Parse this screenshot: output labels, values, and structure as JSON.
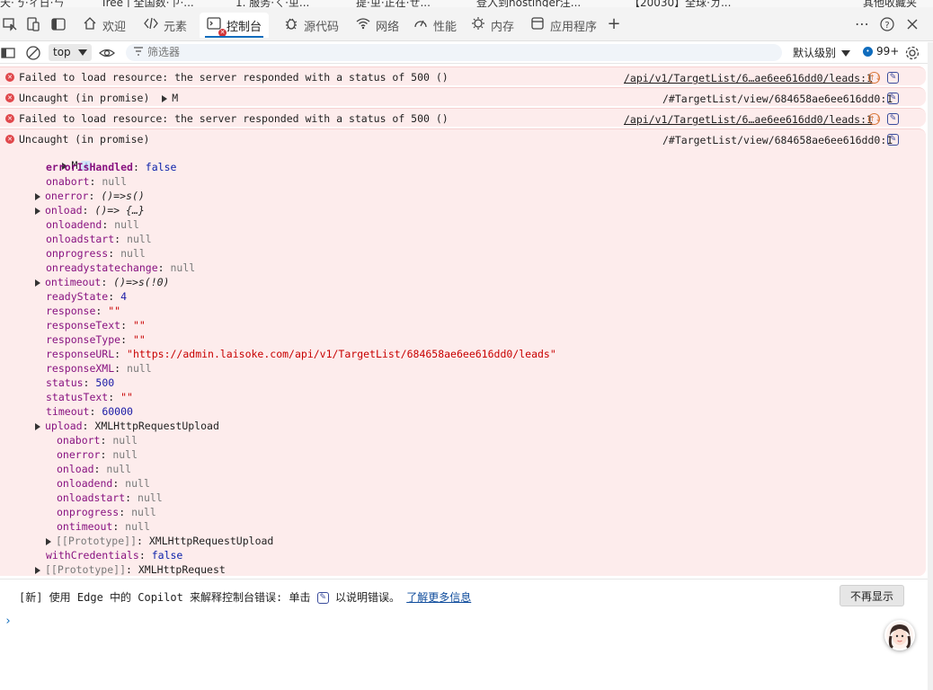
{
  "bookmarks": [
    {
      "label": "天·ㄋ·ㄔ日·ㄣ"
    },
    {
      "label": "Tree | 全国数·ㄗ·..."
    },
    {
      "label": "1. 服务·ㄑ·ㄓ..."
    },
    {
      "label": "提·ㄓ·正在·ㄝ..."
    },
    {
      "label": "登入到hostinger注..."
    },
    {
      "label": "【20030】全球·ㄉ..."
    },
    {
      "label": "其他收藏夹"
    }
  ],
  "tabs": [
    {
      "label": "欢迎",
      "icon": "home-icon"
    },
    {
      "label": "元素",
      "icon": "code-icon"
    },
    {
      "label": "控制台",
      "icon": "console-icon",
      "active": true
    },
    {
      "label": "源代码",
      "icon": "bug-icon"
    },
    {
      "label": "网络",
      "icon": "wifi-icon"
    },
    {
      "label": "性能",
      "icon": "gauge-icon"
    },
    {
      "label": "内存",
      "icon": "memory-icon"
    },
    {
      "label": "应用程序",
      "icon": "app-icon"
    }
  ],
  "toolbar": {
    "context": "top",
    "filter_placeholder": "筛选器",
    "levels": "默认级别",
    "count": "99+"
  },
  "messages": [
    {
      "text": "Failed to load resource: the server responded with a status of 500 ()",
      "source": "/api/v1/TargetList/6…ae6ee616dd0/leads:1"
    },
    {
      "text": "Uncaught (in promise)",
      "inline": "M",
      "source": "/#TargetList/view/684658ae6ee616dd0:1"
    },
    {
      "text": "Failed to load resource: the server responded with a status of 500 ()",
      "source": "/api/v1/TargetList/6…ae6ee616dd0/leads:1"
    },
    {
      "text": "Uncaught (in promise)",
      "source": "/#TargetList/view/684658ae6ee616dd0:1"
    }
  ],
  "tree": {
    "root": "M",
    "lines": [
      {
        "key": "errorIsHandled",
        "value": "false",
        "type": "kw",
        "bold": true
      },
      {
        "key": "onabort",
        "value": "null",
        "type": "null"
      },
      {
        "key": "onerror",
        "value": "()=>s()",
        "type": "fn",
        "expand": true
      },
      {
        "key": "onload",
        "value": "()=> {…}",
        "type": "fn",
        "expand": true
      },
      {
        "key": "onloadend",
        "value": "null",
        "type": "null"
      },
      {
        "key": "onloadstart",
        "value": "null",
        "type": "null"
      },
      {
        "key": "onprogress",
        "value": "null",
        "type": "null"
      },
      {
        "key": "onreadystatechange",
        "value": "null",
        "type": "null"
      },
      {
        "key": "ontimeout",
        "value": "()=>s(!0)",
        "type": "fn",
        "expand": true
      },
      {
        "key": "readyState",
        "value": "4",
        "type": "num"
      },
      {
        "key": "response",
        "value": "\"\"",
        "type": "str"
      },
      {
        "key": "responseText",
        "value": "\"\"",
        "type": "str"
      },
      {
        "key": "responseType",
        "value": "\"\"",
        "type": "str"
      },
      {
        "key": "responseURL",
        "value": "\"https://admin.laisoke.com/api/v1/TargetList/684658ae6ee616dd0/leads\"",
        "type": "str"
      },
      {
        "key": "responseXML",
        "value": "null",
        "type": "null"
      },
      {
        "key": "status",
        "value": "500",
        "type": "num"
      },
      {
        "key": "statusText",
        "value": "\"\"",
        "type": "str"
      },
      {
        "key": "timeout",
        "value": "60000",
        "type": "num"
      },
      {
        "key": "upload",
        "value": "XMLHttpRequestUpload",
        "type": "obj",
        "expand": true
      }
    ],
    "upload_lines": [
      {
        "key": "onabort",
        "value": "null"
      },
      {
        "key": "onerror",
        "value": "null"
      },
      {
        "key": "onload",
        "value": "null"
      },
      {
        "key": "onloadend",
        "value": "null"
      },
      {
        "key": "onloadstart",
        "value": "null"
      },
      {
        "key": "onprogress",
        "value": "null"
      },
      {
        "key": "ontimeout",
        "value": "null"
      }
    ],
    "upload_proto": {
      "key": "[[Prototype]]",
      "value": "XMLHttpRequestUpload"
    },
    "with_credentials": {
      "key": "withCredentials",
      "value": "false"
    },
    "proto": {
      "key": "[[Prototype]]",
      "value": "XMLHttpRequest"
    }
  },
  "hint": {
    "prefix": "[新] 使用 Edge 中的 Copilot 来解释控制台错误: 单击",
    "middle": "以说明错误。",
    "link": "了解更多信息",
    "dismiss": "不再显示"
  },
  "prompt": "›"
}
